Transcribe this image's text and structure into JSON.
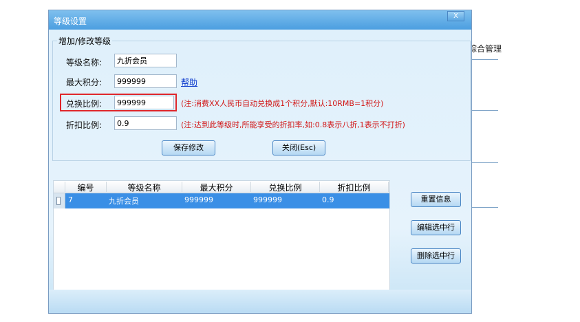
{
  "background": {
    "side_text": "综合管理"
  },
  "dialog": {
    "title": "等级设置",
    "close_label": "X",
    "group_title": "增加/修改等级",
    "fields": {
      "level_name_label": "等级名称:",
      "level_name_value": "九折会员",
      "max_points_label": "最大积分:",
      "max_points_value": "999999",
      "help_link": "帮助",
      "exchange_ratio_label": "兑换比例:",
      "exchange_ratio_value": "999999",
      "exchange_note": "(注:消费XX人民币自动兑换成1个积分,默认:10RMB=1积分)",
      "discount_label": "折扣比例:",
      "discount_value": "0.9",
      "discount_note": "(注:达到此等级时,所能享受的折扣率,如:0.8表示八折,1表示不打折)"
    },
    "buttons": {
      "save": "保存修改",
      "close": "关闭(Esc)",
      "reset": "重置信息",
      "edit_selected": "编辑选中行",
      "delete_selected": "删除选中行"
    },
    "table": {
      "headers": [
        "编号",
        "等级名称",
        "最大积分",
        "兑换比例",
        "折扣比例"
      ],
      "rows": [
        [
          "7",
          "九折会员",
          "999999",
          "999999",
          "0.9"
        ]
      ]
    },
    "colors": {
      "accent": "#3a8fe6",
      "highlight_border": "#e0262b",
      "note_text": "#d21515"
    }
  }
}
